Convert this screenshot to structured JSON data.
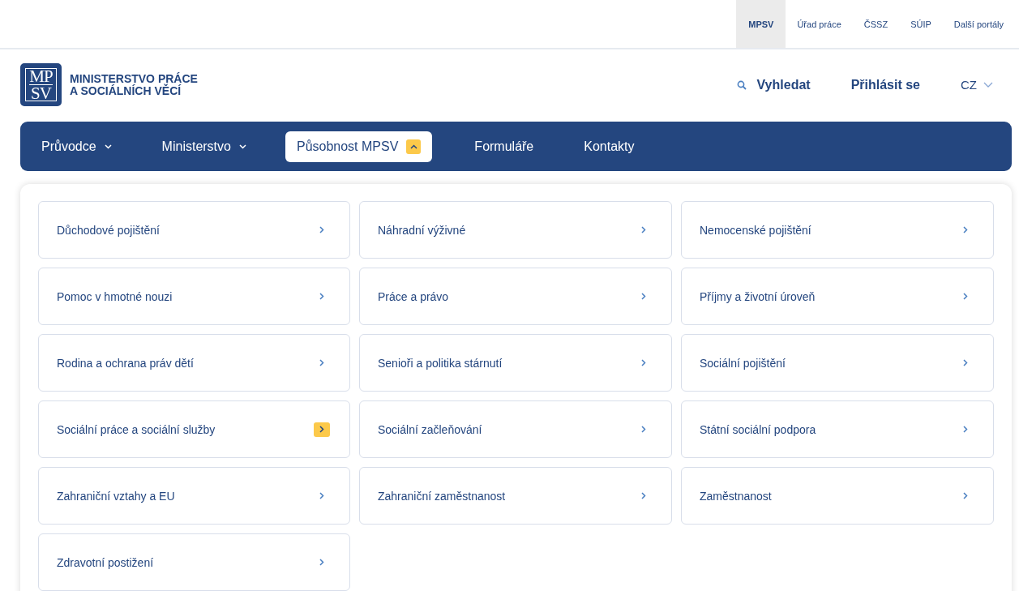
{
  "portals": [
    {
      "label": "MPSV",
      "selected": true
    },
    {
      "label": "Úřad práce",
      "selected": false
    },
    {
      "label": "ČSSZ",
      "selected": false
    },
    {
      "label": "SÚIP",
      "selected": false
    },
    {
      "label": "Další portály",
      "selected": false
    }
  ],
  "logo": {
    "mark_top": "MP",
    "mark_bottom": "SV",
    "line1": "MINISTERSTVO PRÁCE",
    "line2": "A SOCIÁLNÍCH VĚCÍ"
  },
  "search": "Vyhledat",
  "login": "Přihlásit se",
  "language": "CZ",
  "nav": [
    {
      "label": "Průvodce",
      "selected": false,
      "dropdown": true
    },
    {
      "label": "Ministerstvo",
      "selected": false,
      "dropdown": true
    },
    {
      "label": "Působnost MPSV",
      "selected": true,
      "dropdown": true
    },
    {
      "label": "Formuláře",
      "selected": false,
      "dropdown": false
    },
    {
      "label": "Kontakty",
      "selected": false,
      "dropdown": false
    }
  ],
  "menu_items": [
    {
      "label": "Důchodové pojištění",
      "selected": false
    },
    {
      "label": "Náhradní výživné",
      "selected": false
    },
    {
      "label": "Nemocenské pojištění",
      "selected": false
    },
    {
      "label": "Pomoc v hmotné nouzi",
      "selected": false
    },
    {
      "label": "Práce a právo",
      "selected": false
    },
    {
      "label": "Příjmy a životní úroveň",
      "selected": false
    },
    {
      "label": "Rodina a ochrana práv dětí",
      "selected": false
    },
    {
      "label": "Senioři a politika stárnutí",
      "selected": false
    },
    {
      "label": "Sociální pojištění",
      "selected": false
    },
    {
      "label": "Sociální práce a sociální služby",
      "selected": true
    },
    {
      "label": "Sociální začleňování",
      "selected": false
    },
    {
      "label": "Státní sociální podpora",
      "selected": false
    },
    {
      "label": "Zahraniční vztahy a EU",
      "selected": false
    },
    {
      "label": "Zahraniční zaměstnanost",
      "selected": false
    },
    {
      "label": "Zaměstnanost",
      "selected": false
    },
    {
      "label": "Zdravotní postižení",
      "selected": false
    }
  ]
}
